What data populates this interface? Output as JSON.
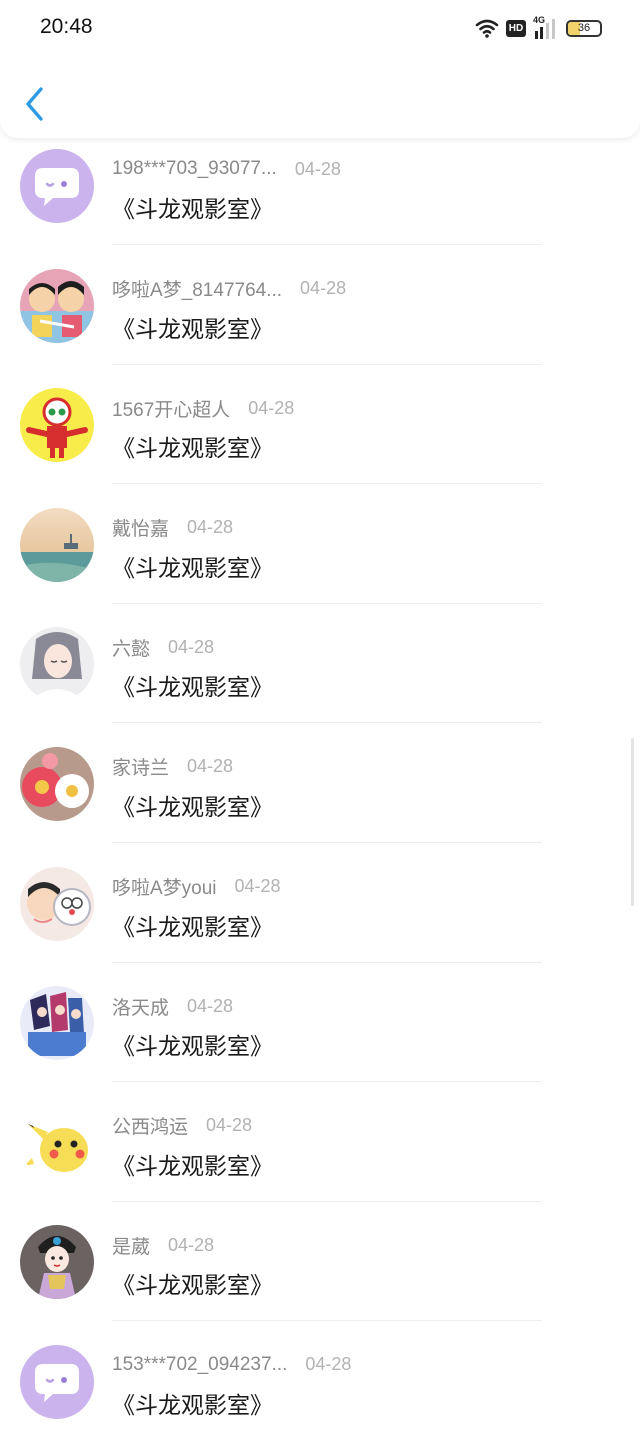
{
  "status_bar": {
    "time": "20:48",
    "hd_label": "HD",
    "network_label": "4G",
    "battery_level": 36
  },
  "header": {
    "back_icon": "chevron-left-icon",
    "accent_color": "#2e9be6"
  },
  "comments": [
    {
      "username": "198***703_93077...",
      "date": "04-28",
      "message": "《斗龙观影室》",
      "avatar": "chat-bubble"
    },
    {
      "username": "哆啦A梦_8147764...",
      "date": "04-28",
      "message": "《斗龙观影室》",
      "avatar": "doraemon-pair"
    },
    {
      "username": "1567开心超人",
      "date": "04-28",
      "message": "《斗龙观影室》",
      "avatar": "hero-yellow"
    },
    {
      "username": "戴怡嘉",
      "date": "04-28",
      "message": "《斗龙观影室》",
      "avatar": "sea-ship"
    },
    {
      "username": "六懿",
      "date": "04-28",
      "message": "《斗龙观影室》",
      "avatar": "anime-girl"
    },
    {
      "username": "家诗兰",
      "date": "04-28",
      "message": "《斗龙观影室》",
      "avatar": "flowers"
    },
    {
      "username": "哆啦A梦youi",
      "date": "04-28",
      "message": "《斗龙观影室》",
      "avatar": "nobita-doraemon"
    },
    {
      "username": "洛天成",
      "date": "04-28",
      "message": "《斗龙观影室》",
      "avatar": "anime-group"
    },
    {
      "username": "公西鸿运",
      "date": "04-28",
      "message": "《斗龙观影室》",
      "avatar": "pikachu"
    },
    {
      "username": "是葳",
      "date": "04-28",
      "message": "《斗龙观影室》",
      "avatar": "opera-doll"
    },
    {
      "username": "153***702_094237...",
      "date": "04-28",
      "message": "《斗龙观影室》",
      "avatar": "chat-bubble"
    }
  ]
}
